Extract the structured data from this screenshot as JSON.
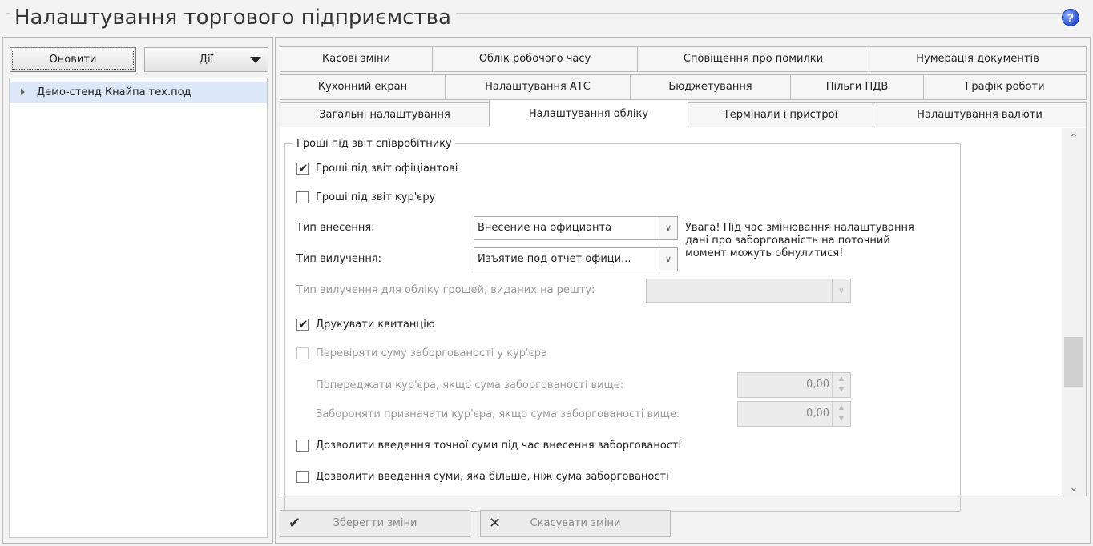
{
  "page": {
    "title": "Налаштування торгового підприємства"
  },
  "left": {
    "refresh_label": "Оновити",
    "actions_label": "Дії",
    "tree": [
      {
        "label": "Демо-стенд Кнайпа тех.под"
      }
    ]
  },
  "tabs": {
    "row1": [
      "Касові зміни",
      "Облік робочого часу",
      "Сповіщення про помилки",
      "Нумерація документів"
    ],
    "row2": [
      "Кухонний екран",
      "Налаштування АТС",
      "Бюджетування",
      "Пільги ПДВ",
      "Графік роботи"
    ],
    "row3": [
      "Загальні налаштування",
      "Налаштування обліку",
      "Термінали і пристрої",
      "Налаштування валюти"
    ],
    "active": "Налаштування обліку"
  },
  "section": {
    "title": "Гроші під звіт співробітнику",
    "cb_waiter": {
      "label": "Гроші під звіт офіціантові",
      "checked": true
    },
    "cb_courier": {
      "label": "Гроші під звіт кур'єру",
      "checked": false
    },
    "deposit_type_label": "Тип внесення:",
    "deposit_type_value": "Внесение на официанта",
    "withdraw_type_label": "Тип вилучення:",
    "withdraw_type_value": "Изъятие под отчет офици...",
    "warning": "Увага! Під час змінювання налаштування дані про заборгованість на поточний момент можуть обнулитися!",
    "change_withdraw_label": "Тип вилучення для обліку грошей, виданих на решту:",
    "change_withdraw_value": "",
    "cb_print": {
      "label": "Друкувати квитанцію",
      "checked": true
    },
    "cb_check_debt": {
      "label": "Перевіряти суму заборгованості у кур'єра",
      "checked": false
    },
    "warn_courier_label": "Попереджати кур'єра, якщо сума заборгованості вище:",
    "warn_courier_value": "0,00",
    "forbid_courier_label": "Забороняти призначати кур'єра, якщо сума заборгованості вище:",
    "forbid_courier_value": "0,00",
    "cb_exact_sum": {
      "label": "Дозволити введення точної суми під час внесення заборгованості",
      "checked": false
    },
    "cb_more_sum": {
      "label": "Дозволити введення суми, яка більше, ніж сума заборгованості",
      "checked": false
    }
  },
  "footer": {
    "save_label": "Зберегти зміни",
    "cancel_label": "Скасувати зміни"
  },
  "icons": {
    "help": "help-icon",
    "save": "check-icon",
    "cancel": "close-icon"
  },
  "colors": {
    "selection": "#dce8f7",
    "help_icon": "#2a4fd0"
  }
}
